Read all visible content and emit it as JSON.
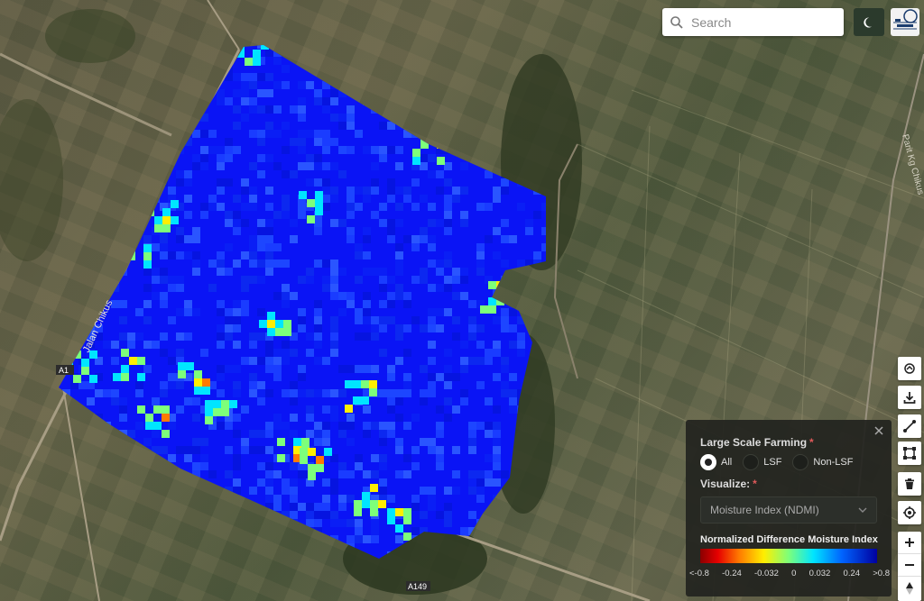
{
  "search": {
    "placeholder": "Search"
  },
  "map": {
    "road_labels": [
      "Jalan Chikus",
      "A149",
      "A1",
      "Parit Kg Chikus"
    ]
  },
  "panel": {
    "farming_label": "Large Scale Farming",
    "required_mark": "*",
    "farming_options": [
      {
        "label": "All",
        "selected": true
      },
      {
        "label": "LSF",
        "selected": false
      },
      {
        "label": "Non-LSF",
        "selected": false
      }
    ],
    "visualize_label": "Visualize:",
    "visualize_value": "Moisture Index (NDMI)",
    "legend_title": "Normalized Difference Moisture Index",
    "legend_ticks": [
      "<-0.8",
      "-0.24",
      "-0.032",
      "0",
      "0.032",
      "0.24",
      ">0.8"
    ]
  },
  "icons": {
    "search": "search-icon",
    "theme": "moon-icon",
    "logo": "logo",
    "tools": [
      "layers-icon",
      "download-icon",
      "draw-line-icon",
      "draw-polygon-icon",
      "trash-icon",
      "locate-icon"
    ],
    "zoom": [
      "zoom-in-icon",
      "zoom-out-icon",
      "compass-icon"
    ]
  },
  "colors": {
    "field_base": "#0a14ff",
    "panel_bg": "#22241f",
    "required": "#e05a5a"
  }
}
